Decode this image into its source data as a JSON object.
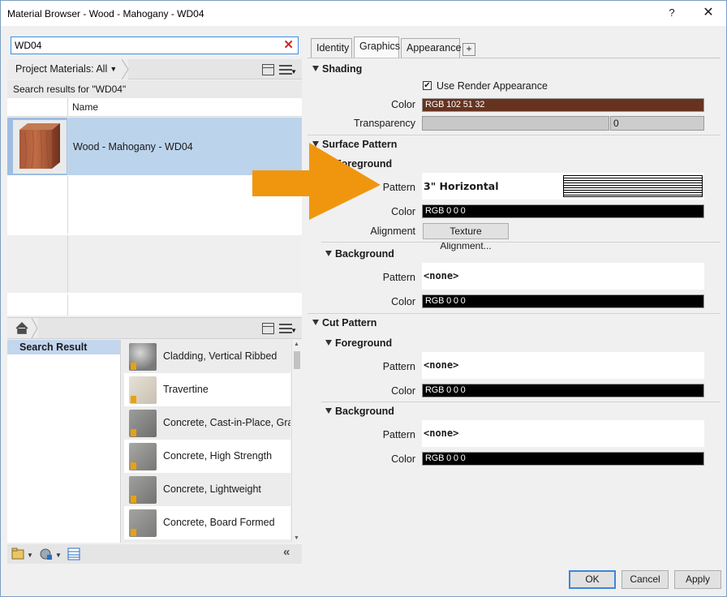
{
  "window": {
    "title": "Material Browser - Wood - Mahogany - WD04",
    "help_label": "?",
    "close_label": "✕"
  },
  "search": {
    "value": "WD04",
    "clear_icon": "red-x-icon"
  },
  "project": {
    "breadcrumb": "Project Materials: All",
    "results_label": "Search results for \"WD04\"",
    "column_name": "Name",
    "rows": [
      {
        "name": "Wood - Mahogany - WD04",
        "selected": true
      }
    ]
  },
  "library": {
    "tree_item": "Search Result",
    "items": [
      {
        "name": "Cladding, Vertical Ribbed",
        "swatch": "#8f8f8f"
      },
      {
        "name": "Travertine",
        "swatch": "#d9d2c6"
      },
      {
        "name": "Concrete, Cast-in-Place, Gray",
        "swatch": "#8c8c8a"
      },
      {
        "name": "Concrete, High Strength",
        "swatch": "#9a9a98"
      },
      {
        "name": "Concrete, Lightweight",
        "swatch": "#8e8e8c"
      },
      {
        "name": "Concrete, Board Formed",
        "swatch": "#959593"
      }
    ]
  },
  "tabs": [
    {
      "label": "Identity",
      "active": false
    },
    {
      "label": "Graphics",
      "active": true
    },
    {
      "label": "Appearance",
      "active": false
    },
    {
      "label": "+",
      "active": false
    }
  ],
  "graphics": {
    "shading": {
      "title": "Shading",
      "use_render_label": "Use Render Appearance",
      "use_render_checked": true,
      "color_label": "Color",
      "color_value": "RGB 102 51 32",
      "color_hex": "#663320",
      "transparency_label": "Transparency",
      "transparency_value": "0"
    },
    "surface": {
      "title": "Surface Pattern",
      "foreground_title": "Foreground",
      "pattern_label": "Pattern",
      "pattern_value": "3\" Horizontal",
      "color_label": "Color",
      "color_value": "RGB 0 0 0",
      "alignment_label": "Alignment",
      "alignment_button": "Texture Alignment...",
      "background_title": "Background",
      "bg_pattern_label": "Pattern",
      "bg_pattern_value": "<none>",
      "bg_color_label": "Color",
      "bg_color_value": "RGB 0 0 0"
    },
    "cut": {
      "title": "Cut Pattern",
      "foreground_title": "Foreground",
      "pattern_label": "Pattern",
      "pattern_value": "<none>",
      "color_label": "Color",
      "color_value": "RGB 0 0 0",
      "background_title": "Background",
      "bg_pattern_label": "Pattern",
      "bg_pattern_value": "<none>",
      "bg_color_label": "Color",
      "bg_color_value": "RGB 0 0 0"
    }
  },
  "buttons": {
    "ok": "OK",
    "cancel": "Cancel",
    "apply": "Apply"
  },
  "colors": {
    "accent": "#3b87d9",
    "selection": "#bcd3ec",
    "callout_arrow": "#f0960e"
  }
}
